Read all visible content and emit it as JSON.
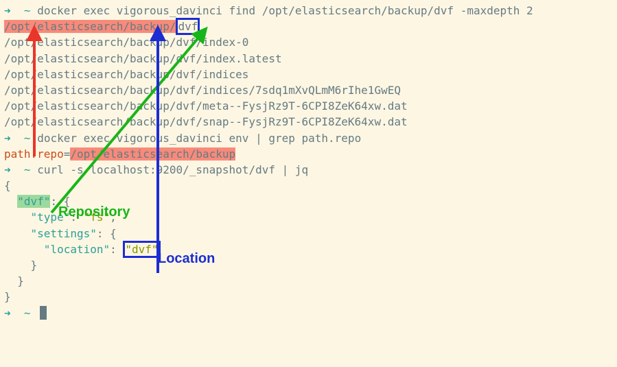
{
  "cmd1": {
    "arrow": "➜",
    "tilde": "~",
    "text": "docker exec vigorous_davinci find /opt/elasticsearch/backup/dvf -maxdepth 2"
  },
  "out1": {
    "l1a": "/opt/elasticsearch/backup/",
    "l1b": "dvf",
    "l2": "/opt/elasticsearch/backup/dvf/index-0",
    "l3": "/opt/elasticsearch/backup/dvf/index.latest",
    "l4": "/opt/elasticsearch/backup/dvf/indices",
    "l5": "/opt/elasticsearch/backup/dvf/indices/7sdq1mXvQLmM6rIhe1GwEQ",
    "l6": "/opt/elasticsearch/backup/dvf/meta--FysjRz9T-6CPI8ZeK64xw.dat",
    "l7": "/opt/elasticsearch/backup/dvf/snap--FysjRz9T-6CPI8ZeK64xw.dat"
  },
  "cmd2": {
    "arrow": "➜",
    "tilde": "~",
    "text": "docker exec vigorous_davinci env | grep path.repo"
  },
  "out2": {
    "key": "path.repo",
    "eq": "=",
    "val": "/opt/elasticsearch/backup"
  },
  "cmd3": {
    "arrow": "➜",
    "tilde": "~",
    "text": "curl -s localhost:9200/_snapshot/dvf | jq"
  },
  "json": {
    "open": "{",
    "dvf_key": "\"dvf\"",
    "dvf_colon": ": {",
    "type_key": "    \"type\"",
    "type_val": ": \"fs\",",
    "type_val_str": "\"fs\"",
    "type_comma": ",",
    "settings_key": "    \"settings\"",
    "settings_colon": ": {",
    "location_key": "      \"location\"",
    "location_colon": ": ",
    "location_val": "\"dvf\"",
    "close1": "    }",
    "close2": "  }",
    "close3": "}"
  },
  "cmd4": {
    "arrow": "➜",
    "tilde": "~"
  },
  "labels": {
    "repository": "Repository",
    "location": "Location"
  }
}
